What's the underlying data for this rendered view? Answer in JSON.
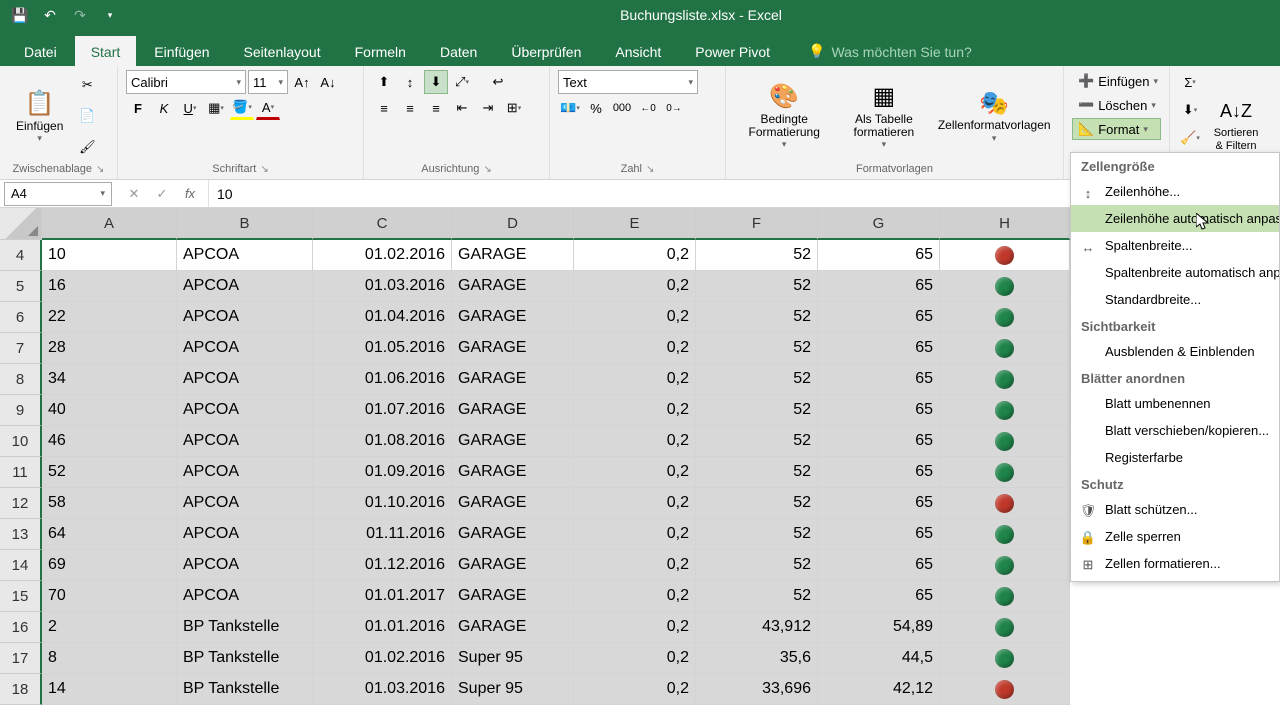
{
  "titlebar": {
    "title": "Buchungsliste.xlsx - Excel"
  },
  "tabs": {
    "items": [
      "Datei",
      "Start",
      "Einfügen",
      "Seitenlayout",
      "Formeln",
      "Daten",
      "Überprüfen",
      "Ansicht",
      "Power Pivot"
    ],
    "tellme": "Was möchten Sie tun?"
  },
  "ribbon": {
    "clipboard": {
      "label": "Zwischenablage",
      "paste": "Einfügen"
    },
    "font": {
      "label": "Schriftart",
      "name": "Calibri",
      "size": "11"
    },
    "alignment": {
      "label": "Ausrichtung"
    },
    "number": {
      "label": "Zahl",
      "format": "Text"
    },
    "styles": {
      "label": "Formatvorlagen",
      "cond": "Bedingte Formatierung",
      "table": "Als Tabelle formatieren",
      "cell": "Zellenformatvorlagen"
    },
    "cells": {
      "insert": "Einfügen",
      "delete": "Löschen",
      "format": "Format"
    },
    "editing": {
      "sortfilter": "Sortieren & Filtern"
    }
  },
  "formula": {
    "namebox": "A4",
    "value": "10"
  },
  "columns": [
    "A",
    "B",
    "C",
    "D",
    "E",
    "F",
    "G",
    "H"
  ],
  "rows": [
    {
      "n": "4",
      "a": "10",
      "b": "APCOA",
      "c": "01.02.2016",
      "d": "GARAGE",
      "e": "0,2",
      "f": "52",
      "g": "65",
      "dot": "red"
    },
    {
      "n": "5",
      "a": "16",
      "b": "APCOA",
      "c": "01.03.2016",
      "d": "GARAGE",
      "e": "0,2",
      "f": "52",
      "g": "65",
      "dot": "green"
    },
    {
      "n": "6",
      "a": "22",
      "b": "APCOA",
      "c": "01.04.2016",
      "d": "GARAGE",
      "e": "0,2",
      "f": "52",
      "g": "65",
      "dot": "green"
    },
    {
      "n": "7",
      "a": "28",
      "b": "APCOA",
      "c": "01.05.2016",
      "d": "GARAGE",
      "e": "0,2",
      "f": "52",
      "g": "65",
      "dot": "green"
    },
    {
      "n": "8",
      "a": "34",
      "b": "APCOA",
      "c": "01.06.2016",
      "d": "GARAGE",
      "e": "0,2",
      "f": "52",
      "g": "65",
      "dot": "green"
    },
    {
      "n": "9",
      "a": "40",
      "b": "APCOA",
      "c": "01.07.2016",
      "d": "GARAGE",
      "e": "0,2",
      "f": "52",
      "g": "65",
      "dot": "green"
    },
    {
      "n": "10",
      "a": "46",
      "b": "APCOA",
      "c": "01.08.2016",
      "d": "GARAGE",
      "e": "0,2",
      "f": "52",
      "g": "65",
      "dot": "green"
    },
    {
      "n": "11",
      "a": "52",
      "b": "APCOA",
      "c": "01.09.2016",
      "d": "GARAGE",
      "e": "0,2",
      "f": "52",
      "g": "65",
      "dot": "green"
    },
    {
      "n": "12",
      "a": "58",
      "b": "APCOA",
      "c": "01.10.2016",
      "d": "GARAGE",
      "e": "0,2",
      "f": "52",
      "g": "65",
      "dot": "red"
    },
    {
      "n": "13",
      "a": "64",
      "b": "APCOA",
      "c": "01.11.2016",
      "d": "GARAGE",
      "e": "0,2",
      "f": "52",
      "g": "65",
      "dot": "green"
    },
    {
      "n": "14",
      "a": "69",
      "b": "APCOA",
      "c": "01.12.2016",
      "d": "GARAGE",
      "e": "0,2",
      "f": "52",
      "g": "65",
      "dot": "green"
    },
    {
      "n": "15",
      "a": "70",
      "b": "APCOA",
      "c": "01.01.2017",
      "d": "GARAGE",
      "e": "0,2",
      "f": "52",
      "g": "65",
      "dot": "green"
    },
    {
      "n": "16",
      "a": "2",
      "b": "BP Tankstelle",
      "c": "01.01.2016",
      "d": "GARAGE",
      "e": "0,2",
      "f": "43,912",
      "g": "54,89",
      "dot": "green"
    },
    {
      "n": "17",
      "a": "8",
      "b": "BP Tankstelle",
      "c": "01.02.2016",
      "d": "Super 95",
      "e": "0,2",
      "f": "35,6",
      "g": "44,5",
      "dot": "green"
    },
    {
      "n": "18",
      "a": "14",
      "b": "BP Tankstelle",
      "c": "01.03.2016",
      "d": "Super 95",
      "e": "0,2",
      "f": "33,696",
      "g": "42,12",
      "dot": "red"
    }
  ],
  "menu": {
    "s1": "Zellengröße",
    "i1": "Zeilenhöhe...",
    "i2": "Zeilenhöhe automatisch anpassen",
    "i3": "Spaltenbreite...",
    "i4": "Spaltenbreite automatisch anpassen",
    "i5": "Standardbreite...",
    "s2": "Sichtbarkeit",
    "i6": "Ausblenden & Einblenden",
    "s3": "Blätter anordnen",
    "i7": "Blatt umbenennen",
    "i8": "Blatt verschieben/kopieren...",
    "i9": "Registerfarbe",
    "s4": "Schutz",
    "i10": "Blatt schützen...",
    "i11": "Zelle sperren",
    "i12": "Zellen formatieren..."
  }
}
